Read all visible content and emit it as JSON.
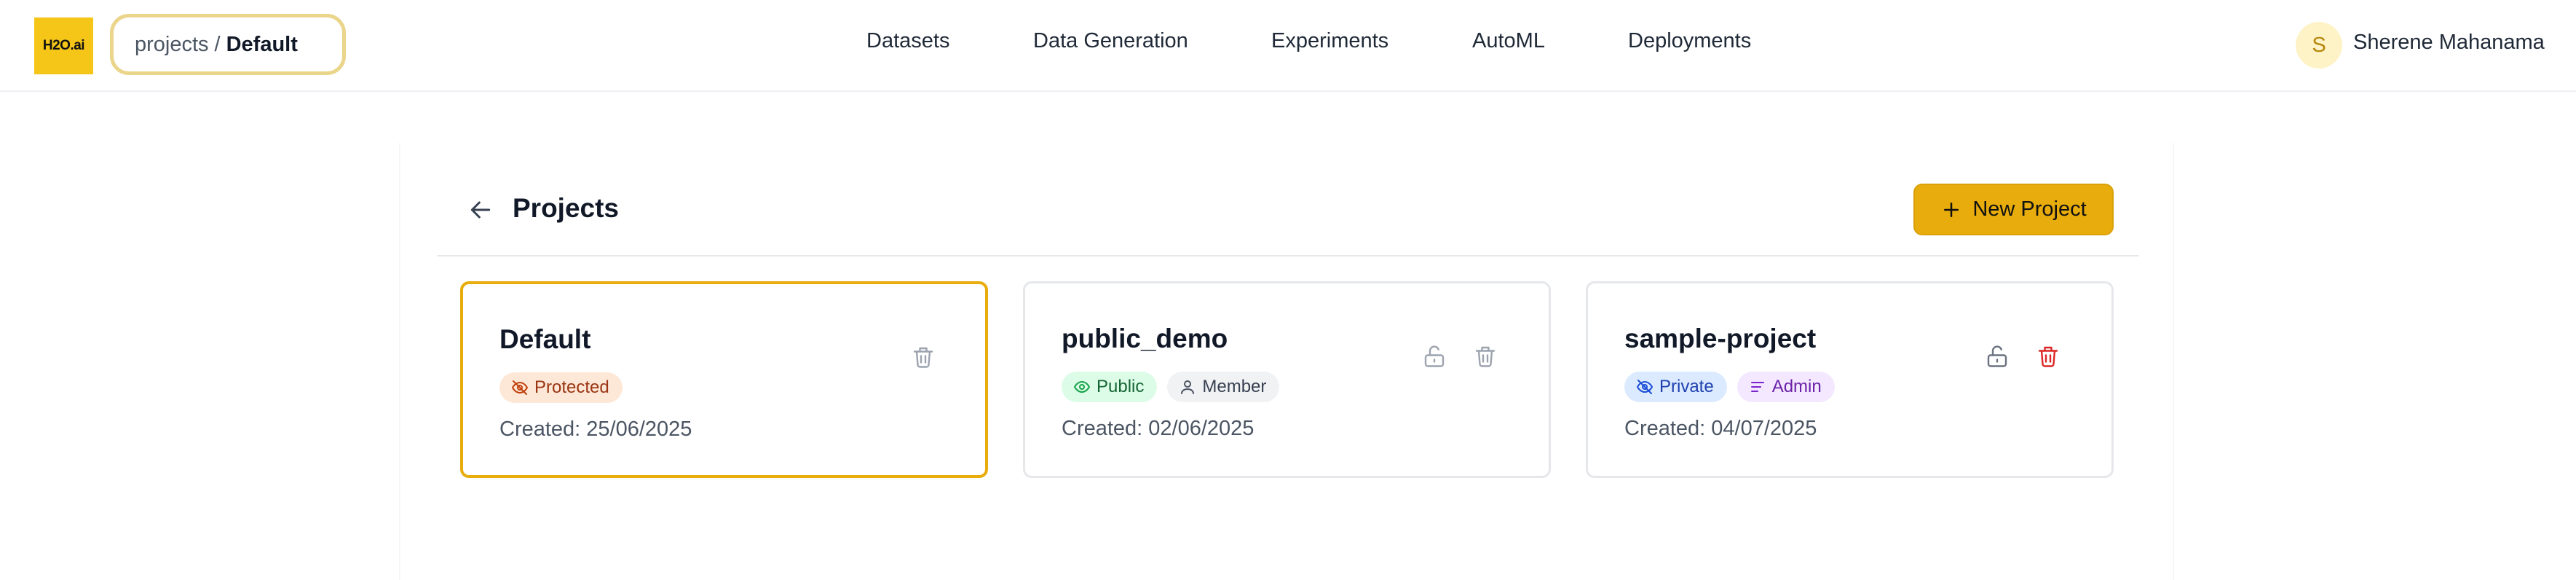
{
  "header": {
    "logo_text": "H2O.ai",
    "breadcrumb": {
      "root": "projects",
      "separator": "/",
      "current": "Default"
    },
    "nav": [
      "Datasets",
      "Data Generation",
      "Experiments",
      "AutoML",
      "Deployments"
    ],
    "user": {
      "initial": "S",
      "name": "Sherene Mahanama"
    }
  },
  "page": {
    "title": "Projects",
    "new_project_label": "New Project"
  },
  "projects": [
    {
      "name": "Default",
      "badges": [
        {
          "label": "Protected",
          "icon": "eye-off-icon",
          "bg": "#fde8d7",
          "fg": "#9a3412"
        }
      ],
      "created": "Created: 25/06/2025",
      "selected": true,
      "actions": [
        "delete"
      ]
    },
    {
      "name": "public_demo",
      "badges": [
        {
          "label": "Public",
          "icon": "eye-icon",
          "bg": "#dcfce7",
          "fg": "#166534"
        },
        {
          "label": "Member",
          "icon": "user-icon",
          "bg": "#f1f2f4",
          "fg": "#374151"
        }
      ],
      "created": "Created: 02/06/2025",
      "selected": false,
      "actions": [
        "unlock",
        "delete"
      ]
    },
    {
      "name": "sample-project",
      "badges": [
        {
          "label": "Private",
          "icon": "eye-off-icon",
          "bg": "#dbeafe",
          "fg": "#1e40af"
        },
        {
          "label": "Admin",
          "icon": "list-icon",
          "bg": "#f3e8ff",
          "fg": "#6b21a8"
        }
      ],
      "created": "Created: 04/07/2025",
      "selected": false,
      "actions": [
        "unlock",
        "delete"
      ]
    }
  ],
  "colors": {
    "accent": "#e8ac0c",
    "delete_active": "#dc2626",
    "icon_muted": "#9ca3af",
    "icon_dark": "#6b7280"
  }
}
